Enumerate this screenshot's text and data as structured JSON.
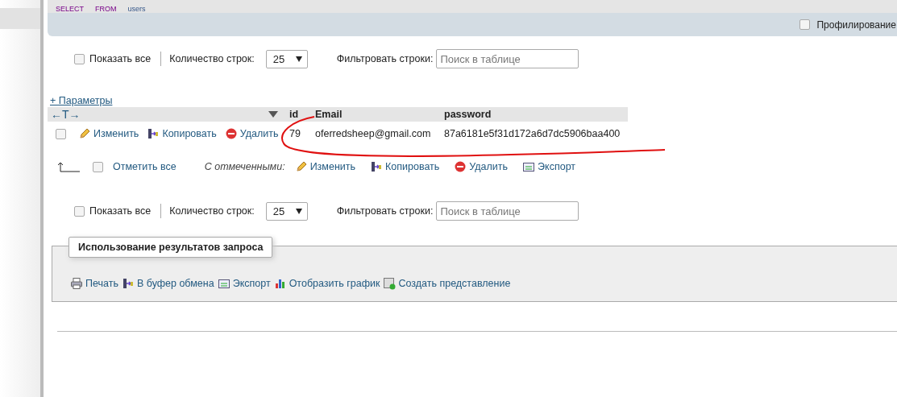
{
  "sql_query": [
    "SELECT",
    "FROM",
    "users"
  ],
  "profiling": {
    "label": "Профилирование",
    "checked": false
  },
  "nav_top": {
    "show_all": {
      "label": "Показать все",
      "checked": false
    },
    "rows_label": "Количество строк:",
    "rows_value": "25",
    "filter_label": "Фильтровать строки:",
    "filter_placeholder": "Поиск в таблице"
  },
  "options_link": "+ Параметры",
  "table": {
    "column_arrows": "←T→",
    "columns": [
      "id",
      "Email",
      "password"
    ],
    "rows": [
      {
        "checked": false,
        "actions": [
          {
            "kind": "edit",
            "label": "Изменить"
          },
          {
            "kind": "copy",
            "label": "Копировать"
          },
          {
            "kind": "delete",
            "label": "Удалить"
          }
        ],
        "cells": [
          "79",
          "oferredsheep@gmail.com",
          "87a6181e5f31d172a6d7dc5906baa400"
        ]
      }
    ]
  },
  "bulk": {
    "check_all": {
      "label": "Отметить все",
      "checked": false
    },
    "with_selected": "С отмеченными:",
    "actions": [
      {
        "kind": "edit",
        "label": "Изменить"
      },
      {
        "kind": "copy",
        "label": "Копировать"
      },
      {
        "kind": "delete",
        "label": "Удалить"
      },
      {
        "kind": "export",
        "label": "Экспорт"
      }
    ]
  },
  "nav_bottom": {
    "show_all": {
      "label": "Показать все",
      "checked": false
    },
    "rows_label": "Количество строк:",
    "rows_value": "25",
    "filter_label": "Фильтровать строки:",
    "filter_placeholder": "Поиск в таблице"
  },
  "query_results": {
    "legend": "Использование результатов запроса",
    "actions": [
      {
        "kind": "print",
        "label": "Печать"
      },
      {
        "kind": "copy",
        "label": "В буфер обмена"
      },
      {
        "kind": "export",
        "label": "Экспорт"
      },
      {
        "kind": "chart",
        "label": "Отобразить график"
      },
      {
        "kind": "view",
        "label": "Создать представление"
      }
    ]
  }
}
